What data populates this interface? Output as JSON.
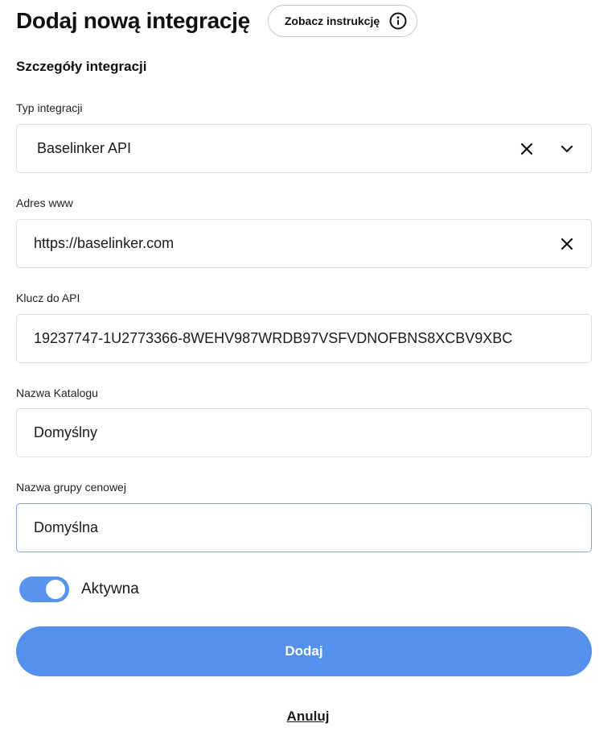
{
  "header": {
    "title": "Dodaj nową integrację",
    "instructions_button": "Zobacz instrukcję"
  },
  "section": {
    "title": "Szczegóły integracji"
  },
  "fields": {
    "integration_type": {
      "label": "Typ integracji",
      "value": "Baselinker API"
    },
    "website": {
      "label": "Adres www",
      "value": "https://baselinker.com"
    },
    "api_key": {
      "label": "Klucz do API",
      "value": "19237747-1U2773366-8WEHV987WRDB97VSFVDNOFBNS8XCBV9XBC"
    },
    "catalog_name": {
      "label": "Nazwa Katalogu",
      "value": "Domyślny"
    },
    "price_group_name": {
      "label": "Nazwa grupy cenowej",
      "value": "Domyślna"
    }
  },
  "active_toggle": {
    "label": "Aktywna",
    "on": true
  },
  "actions": {
    "submit": "Dodaj",
    "cancel": "Anuluj"
  },
  "colors": {
    "accent": "#5591ec",
    "toggle": "#5a93ee",
    "focus_border": "#7fa8e0"
  }
}
